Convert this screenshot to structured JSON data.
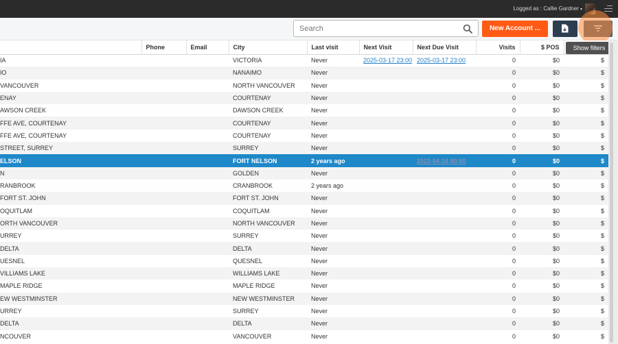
{
  "header": {
    "logged_in_label": "Logged as : Callie Gardner",
    "caret": "▾"
  },
  "toolbar": {
    "search_placeholder": "Search",
    "new_account_label": "New Account ...",
    "tooltip": "Show filters"
  },
  "columns": [
    "",
    "Phone",
    "Email",
    "City",
    "Last visit",
    "Next Visit",
    "Next Due Visit",
    "Visits",
    "$ POS",
    ""
  ],
  "rows": [
    {
      "name": "IA",
      "city": "VICTORIA",
      "last": "Never",
      "next": "2025-03-17 23:00",
      "due": "2025-03-17 23:00",
      "visits": "0",
      "pos": "$0",
      "extra": "$"
    },
    {
      "name": "IO",
      "city": "NANAIMO",
      "last": "Never",
      "next": "",
      "due": "",
      "visits": "0",
      "pos": "$0",
      "extra": "$"
    },
    {
      "name": "VANCOUVER",
      "city": "NORTH VANCOUVER",
      "last": "Never",
      "next": "",
      "due": "",
      "visits": "0",
      "pos": "$0",
      "extra": "$"
    },
    {
      "name": "ENAY",
      "city": "COURTENAY",
      "last": "Never",
      "next": "",
      "due": "",
      "visits": "0",
      "pos": "$0",
      "extra": "$"
    },
    {
      "name": "AWSON CREEK",
      "city": "DAWSON CREEK",
      "last": "Never",
      "next": "",
      "due": "",
      "visits": "0",
      "pos": "$0",
      "extra": "$"
    },
    {
      "name": "FFE AVE, COURTENAY",
      "city": "COURTENAY",
      "last": "Never",
      "next": "",
      "due": "",
      "visits": "0",
      "pos": "$0",
      "extra": "$"
    },
    {
      "name": "FFE AVE, COURTENAY",
      "city": "COURTENAY",
      "last": "Never",
      "next": "",
      "due": "",
      "visits": "0",
      "pos": "$0",
      "extra": "$"
    },
    {
      "name": "STREET, SURREY",
      "city": "SURREY",
      "last": "Never",
      "next": "",
      "due": "",
      "visits": "0",
      "pos": "$0",
      "extra": "$"
    },
    {
      "name": "ELSON",
      "city": "FORT NELSON",
      "last": "2 years ago",
      "next": "",
      "due": "2022-04-16 00:00",
      "visits": "0",
      "pos": "$0",
      "extra": "$",
      "selected": true
    },
    {
      "name": "N",
      "city": "GOLDEN",
      "last": "Never",
      "next": "",
      "due": "",
      "visits": "0",
      "pos": "$0",
      "extra": "$"
    },
    {
      "name": "RANBROOK",
      "city": "CRANBROOK",
      "last": "2 years ago",
      "next": "",
      "due": "",
      "visits": "0",
      "pos": "$0",
      "extra": "$"
    },
    {
      "name": "FORT ST. JOHN",
      "city": "FORT ST. JOHN",
      "last": "Never",
      "next": "",
      "due": "",
      "visits": "0",
      "pos": "$0",
      "extra": "$"
    },
    {
      "name": "OQUITLAM",
      "city": "COQUITLAM",
      "last": "Never",
      "next": "",
      "due": "",
      "visits": "0",
      "pos": "$0",
      "extra": "$"
    },
    {
      "name": "ORTH VANCOUVER",
      "city": "NORTH VANCOUVER",
      "last": "Never",
      "next": "",
      "due": "",
      "visits": "0",
      "pos": "$0",
      "extra": "$"
    },
    {
      "name": "URREY",
      "city": "SURREY",
      "last": "Never",
      "next": "",
      "due": "",
      "visits": "0",
      "pos": "$0",
      "extra": "$"
    },
    {
      "name": "DELTA",
      "city": "DELTA",
      "last": "Never",
      "next": "",
      "due": "",
      "visits": "0",
      "pos": "$0",
      "extra": "$"
    },
    {
      "name": "UESNEL",
      "city": "QUESNEL",
      "last": "Never",
      "next": "",
      "due": "",
      "visits": "0",
      "pos": "$0",
      "extra": "$"
    },
    {
      "name": "VILLIAMS LAKE",
      "city": "WILLIAMS LAKE",
      "last": "Never",
      "next": "",
      "due": "",
      "visits": "0",
      "pos": "$0",
      "extra": "$"
    },
    {
      "name": "MAPLE RIDGE",
      "city": "MAPLE RIDGE",
      "last": "Never",
      "next": "",
      "due": "",
      "visits": "0",
      "pos": "$0",
      "extra": "$"
    },
    {
      "name": "EW WESTMINSTER",
      "city": "NEW WESTMINSTER",
      "last": "Never",
      "next": "",
      "due": "",
      "visits": "0",
      "pos": "$0",
      "extra": "$"
    },
    {
      "name": "URREY",
      "city": "SURREY",
      "last": "Never",
      "next": "",
      "due": "",
      "visits": "0",
      "pos": "$0",
      "extra": "$"
    },
    {
      "name": "DELTA",
      "city": "DELTA",
      "last": "Never",
      "next": "",
      "due": "",
      "visits": "0",
      "pos": "$0",
      "extra": "$"
    },
    {
      "name": "NCOUVER",
      "city": "VANCOUVER",
      "last": "Never",
      "next": "",
      "due": "",
      "visits": "0",
      "pos": "$0",
      "extra": "$"
    }
  ]
}
